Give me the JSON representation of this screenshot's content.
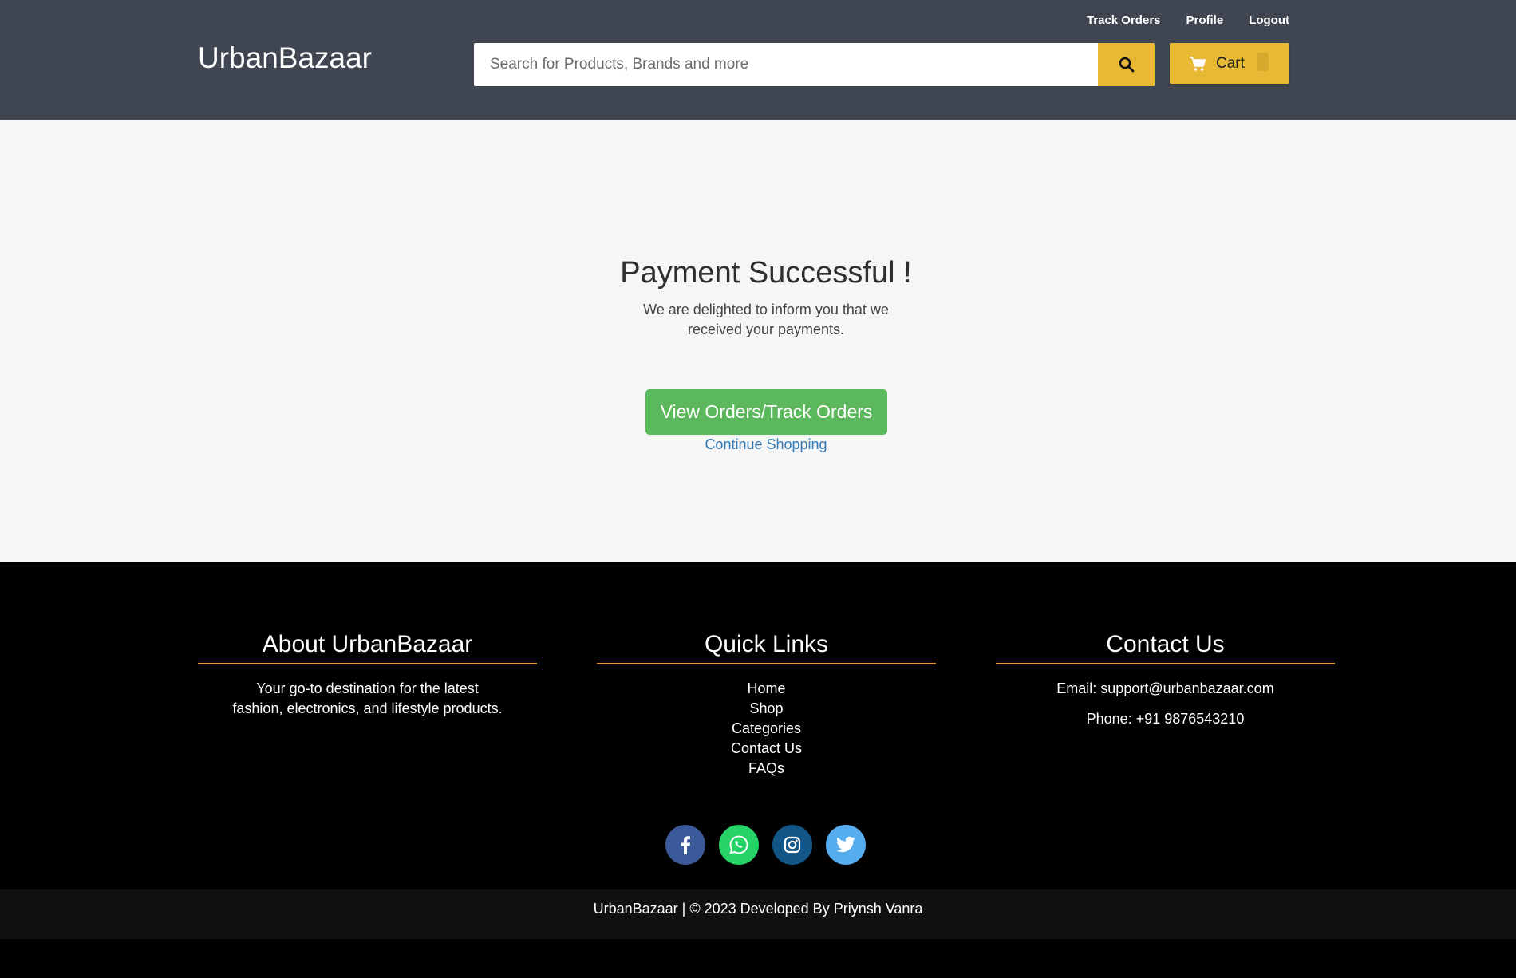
{
  "header": {
    "brand": "UrbanBazaar",
    "links": [
      "Track Orders",
      "Profile",
      "Logout"
    ],
    "search_placeholder": "Search for Products, Brands and more",
    "cart_label": "Cart",
    "cart_count": "",
    "accent_color": "#e8b935",
    "background_color": "#3f4651"
  },
  "main": {
    "title": "Payment Successful !",
    "message": "We are delighted to inform you that we received your payments.",
    "orders_button": "View Orders/Track Orders",
    "continue_link": "Continue Shopping"
  },
  "footer": {
    "about": {
      "heading": "About UrbanBazaar",
      "text": "Your go-to destination for the latest fashion, electronics, and lifestyle products."
    },
    "quick_links": {
      "heading": "Quick Links",
      "items": [
        "Home",
        "Shop",
        "Categories",
        "Contact Us",
        "FAQs"
      ]
    },
    "contact": {
      "heading": "Contact Us",
      "email": "Email: support@urbanbazaar.com",
      "phone": "Phone: +91 9876543210"
    },
    "socials": [
      {
        "icon": "facebook-icon",
        "color": "#3b5998"
      },
      {
        "icon": "whatsapp-icon",
        "color": "#25d366"
      },
      {
        "icon": "instagram-icon",
        "color": "#125688"
      },
      {
        "icon": "twitter-icon",
        "color": "#55acee"
      }
    ],
    "copyright": "UrbanBazaar | © 2023 Developed By Priynsh Vanra"
  }
}
